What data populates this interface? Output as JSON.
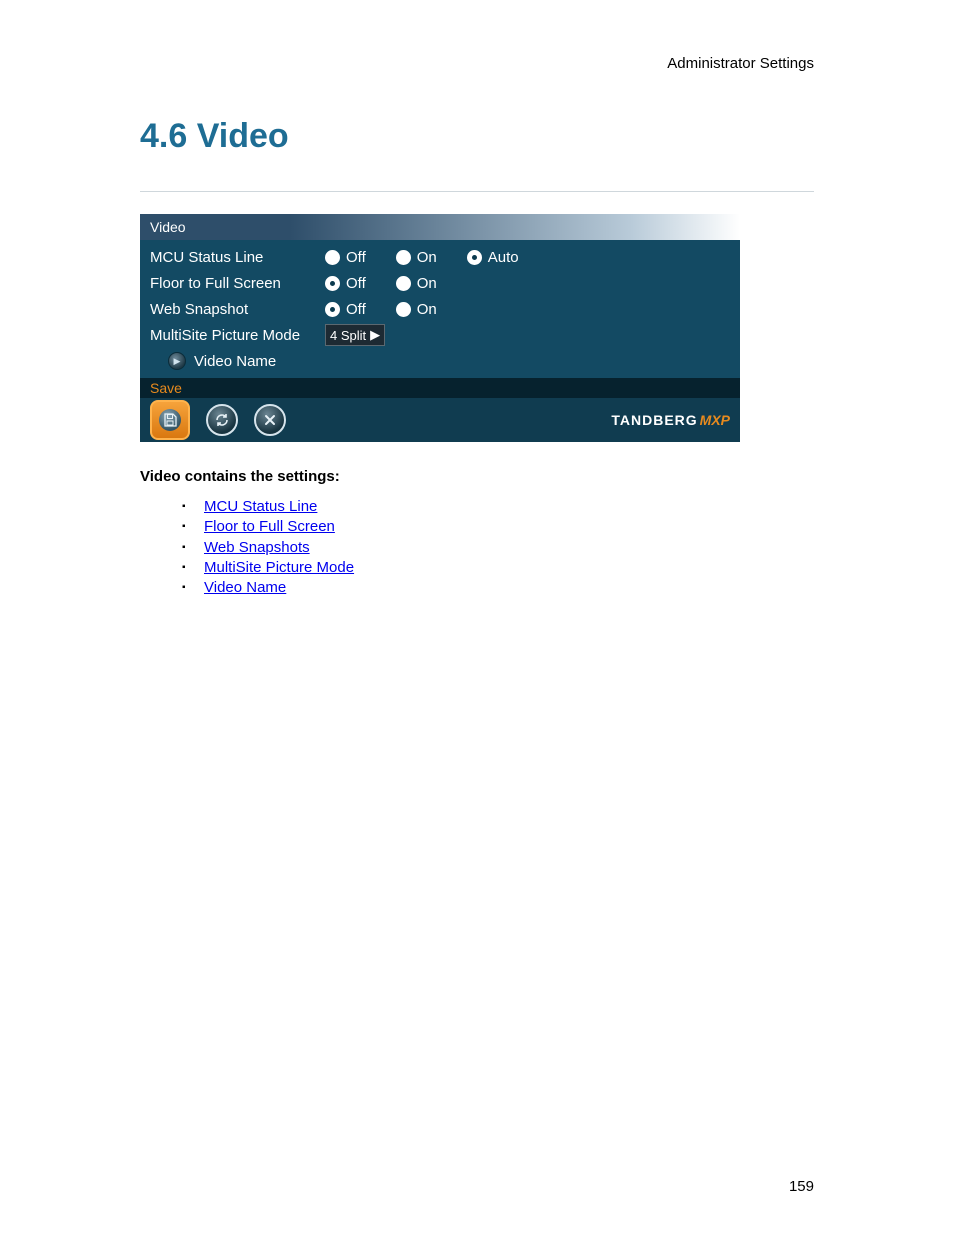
{
  "header": {
    "right": "Administrator Settings"
  },
  "title": "4.6 Video",
  "panel": {
    "title": "Video",
    "rows": [
      {
        "label": "MCU Status Line",
        "opts": [
          "Off",
          "On",
          "Auto"
        ],
        "selected": 2
      },
      {
        "label": "Floor to Full Screen",
        "opts": [
          "Off",
          "On"
        ],
        "selected": 0
      },
      {
        "label": "Web Snapshot",
        "opts": [
          "Off",
          "On"
        ],
        "selected": 0
      },
      {
        "label": "MultiSite Picture Mode",
        "select": "4 Split"
      }
    ],
    "subnav": "Video Name",
    "save_label": "Save",
    "brand": "TANDBERG",
    "brand_suffix": "MXP"
  },
  "subhead": "Video contains the settings:",
  "links": [
    "MCU Status Line",
    "Floor to Full Screen",
    "Web Snapshots",
    "MultiSite Picture Mode",
    "Video Name"
  ],
  "page_number": "159"
}
